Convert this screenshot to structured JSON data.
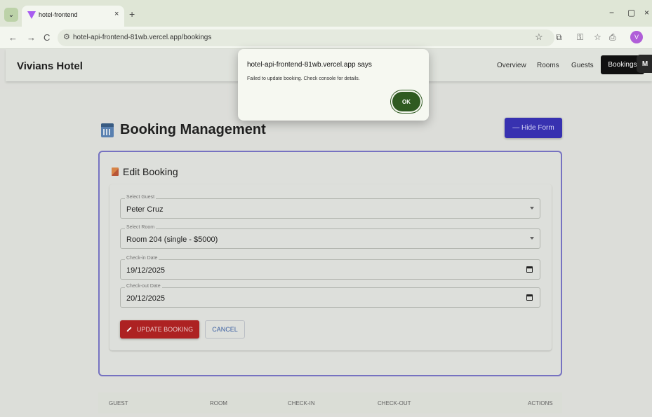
{
  "browser": {
    "tab_title": "hotel-frontend",
    "tab_close": "×",
    "new_tab": "+",
    "url": "hotel-api-frontend-81wb.vercel.app/bookings",
    "back": "←",
    "forward": "→",
    "reload": "C",
    "star": "☆",
    "profile_initial": "V",
    "window_minimize": "−",
    "window_restore": "▢",
    "window_close": "×"
  },
  "appbar": {
    "brand": "Vivians Hotel",
    "nav": [
      "Overview",
      "Rooms",
      "Guests",
      "Bookings"
    ],
    "active": "Bookings"
  },
  "extension_label": "M",
  "page": {
    "heading": "Booking Management",
    "hide_form_label": "— Hide Form"
  },
  "form": {
    "title": "Edit Booking",
    "fields": [
      {
        "label": "Select Guest",
        "value": "Peter Cruz",
        "type": "select"
      },
      {
        "label": "Select Room",
        "value": "Room 204 (single - $5000)",
        "type": "select"
      },
      {
        "label": "Check-in Date",
        "value": "19/12/2025",
        "type": "date"
      },
      {
        "label": "Check-out Date",
        "value": "20/12/2025",
        "type": "date"
      }
    ],
    "update_label": "UPDATE BOOKING",
    "cancel_label": "CANCEL"
  },
  "table": {
    "columns": [
      "GUEST",
      "ROOM",
      "CHECK-IN",
      "CHECK-OUT",
      "ACTIONS"
    ]
  },
  "dialog": {
    "title": "hotel-api-frontend-81wb.vercel.app says",
    "message": "Failed to update booking. Check console for details.",
    "ok_label": "OK"
  },
  "colors": {
    "primary": "#3a33b8",
    "danger": "#b52424",
    "ok": "#2f5a21",
    "accent_border": "#7b77c9"
  }
}
